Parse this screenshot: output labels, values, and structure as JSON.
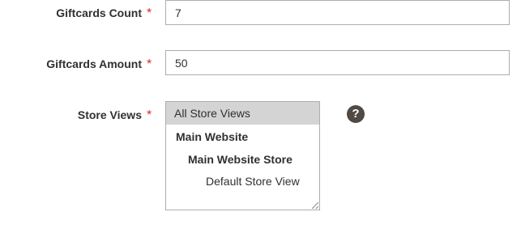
{
  "form": {
    "giftcards_count": {
      "label": "Giftcards Count",
      "required_mark": "*",
      "value": "7"
    },
    "giftcards_amount": {
      "label": "Giftcards Amount",
      "required_mark": "*",
      "value": "50"
    },
    "store_views": {
      "label": "Store Views",
      "required_mark": "*",
      "options": {
        "all": "All Store Views",
        "website": "Main Website",
        "store": "Main Website Store",
        "view": "Default Store View"
      },
      "selected": "All Store Views",
      "help_icon": "question-circle-icon",
      "help_glyph": "?"
    }
  },
  "colors": {
    "required_star": "#e22626",
    "selected_option_bg": "#d4d4d4",
    "help_icon_bg": "#514943",
    "input_border": "#adadad"
  }
}
